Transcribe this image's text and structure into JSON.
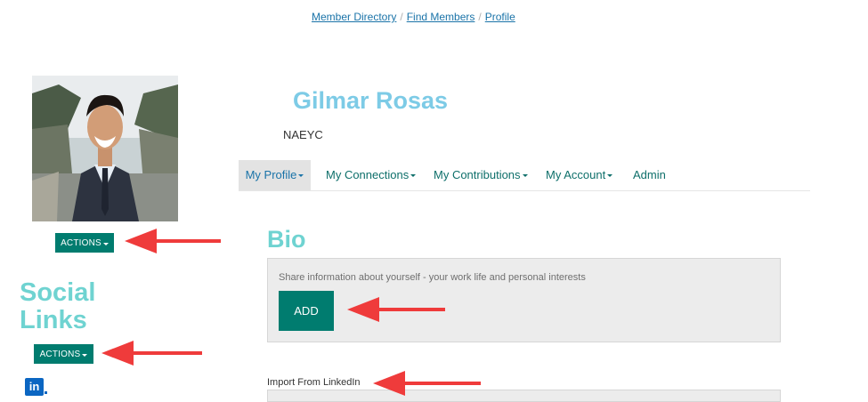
{
  "breadcrumb": {
    "items": [
      "Member Directory",
      "Find Members",
      "Profile"
    ],
    "separator": "/"
  },
  "profile": {
    "name": "Gilmar Rosas",
    "organization": "NAEYC",
    "photo_icon": "profile-photo"
  },
  "actions_label": "ACTIONS",
  "social_links": {
    "title": "Social Links",
    "icons": [
      "linkedin-icon"
    ]
  },
  "tabs": [
    {
      "label": "My Profile",
      "dropdown": true,
      "active": true
    },
    {
      "label": "My Connections",
      "dropdown": true,
      "active": false
    },
    {
      "label": "My Contributions",
      "dropdown": true,
      "active": false
    },
    {
      "label": "My Account",
      "dropdown": true,
      "active": false
    },
    {
      "label": "Admin",
      "dropdown": false,
      "active": false
    }
  ],
  "bio": {
    "title": "Bio",
    "hint": "Share information about yourself - your work life and personal interests",
    "add_label": "ADD"
  },
  "linkedin": {
    "label": "Import From LinkedIn",
    "icon_text": "in"
  },
  "colors": {
    "accent_teal": "#007c6f",
    "heading_cyan": "#6fd3d1",
    "name_blue": "#7dcbe6",
    "link_blue": "#1a73a8",
    "annotation_red": "#ef3b3b",
    "linkedin_blue": "#0b66c2"
  }
}
